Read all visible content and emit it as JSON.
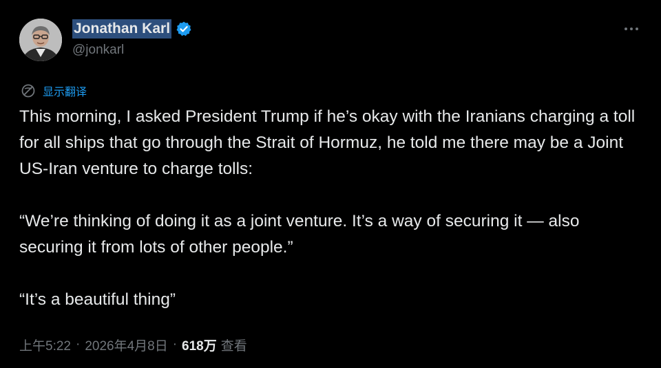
{
  "author": {
    "name": "Jonathan Karl",
    "handle": "@jonkarl",
    "verified": true,
    "verified_color": "#1d9bf0"
  },
  "actions": {
    "more_icon": "more-horizontal-icon"
  },
  "translate": {
    "label": "显示翻译",
    "icon": "translate-globe-icon",
    "color": "#1d9bf0"
  },
  "tweet": {
    "paragraphs": [
      "This morning, I asked President Trump if he’s okay with the Iranians charging a toll for all ships that go through the Strait of Hormuz, he told me there may be a Joint US-Iran venture to charge tolls:",
      "“We’re thinking of doing it as a joint venture. It’s a way of securing it — also securing it from lots of other people.”",
      "“It’s a beautiful thing”"
    ]
  },
  "meta": {
    "time": "上午5:22",
    "separator": "·",
    "date": "2026年4月8日",
    "views_count": "618万",
    "views_label": "查看"
  }
}
